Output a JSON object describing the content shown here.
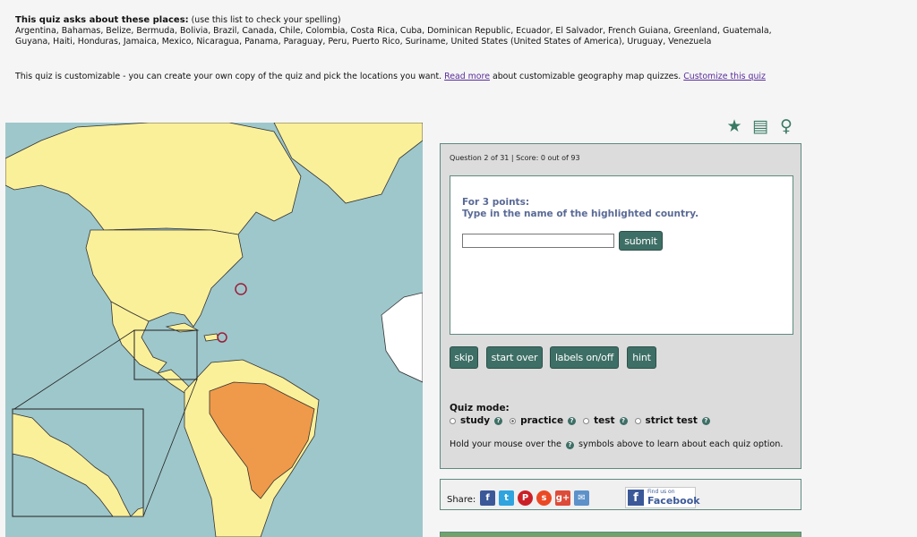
{
  "places": {
    "heading": "This quiz asks about these places:",
    "note": "(use this list to check your spelling)",
    "list": "Argentina, Bahamas, Belize, Bermuda, Bolivia, Brazil, Canada, Chile, Colombia, Costa Rica, Cuba, Dominican Republic, Ecuador, El Salvador, French Guiana, Greenland, Guatemala, Guyana, Haiti, Honduras, Jamaica, Mexico, Nicaragua, Panama, Paraguay, Peru, Puerto Rico, Suriname, United States (United States of America), Uruguay, Venezuela"
  },
  "customizable": {
    "text1": "This quiz is customizable - you can create your own copy of the quiz and pick the locations you want. ",
    "read_more": "Read more",
    "text2": " about customizable geography map quizzes. ",
    "customize": "Customize this quiz"
  },
  "tools": {
    "favorite_icon": "★",
    "notes_icon": "▤",
    "hint_icon": "♀"
  },
  "quiz": {
    "status": "Question 2 of 31 | Score: 0 out of 93",
    "prompt_points": "For 3 points:",
    "prompt_text": "Type in the name of the highlighted country.",
    "answer_value": "",
    "submit": "submit",
    "buttons": {
      "skip": "skip",
      "start_over": "start over",
      "labels": "labels on/off",
      "hint": "hint"
    },
    "mode_label": "Quiz mode:",
    "modes": [
      {
        "label": "study",
        "selected": false
      },
      {
        "label": "practice",
        "selected": true
      },
      {
        "label": "test",
        "selected": false
      },
      {
        "label": "strict test",
        "selected": false
      }
    ],
    "help_text": "Hold your mouse over the",
    "help_text2": "symbols above to learn about each quiz option."
  },
  "share": {
    "label": "Share:",
    "icons": [
      {
        "name": "facebook",
        "glyph": "f",
        "color": "#3b5998"
      },
      {
        "name": "twitter",
        "glyph": "t",
        "color": "#2fa4df"
      },
      {
        "name": "pinterest",
        "glyph": "P",
        "color": "#cb2027"
      },
      {
        "name": "stumbleupon",
        "glyph": "s",
        "color": "#eb4924"
      },
      {
        "name": "google-plus",
        "glyph": "g+",
        "color": "#dd4b39"
      },
      {
        "name": "email",
        "glyph": "✉",
        "color": "#5d91c9"
      }
    ],
    "fb_small": "Find us on",
    "fb_big": "Facebook"
  },
  "colors": {
    "sea": "#9ec7cb",
    "land": "#fbf09a",
    "highlight": "#ef9a4a",
    "accent": "#3e6f66"
  }
}
